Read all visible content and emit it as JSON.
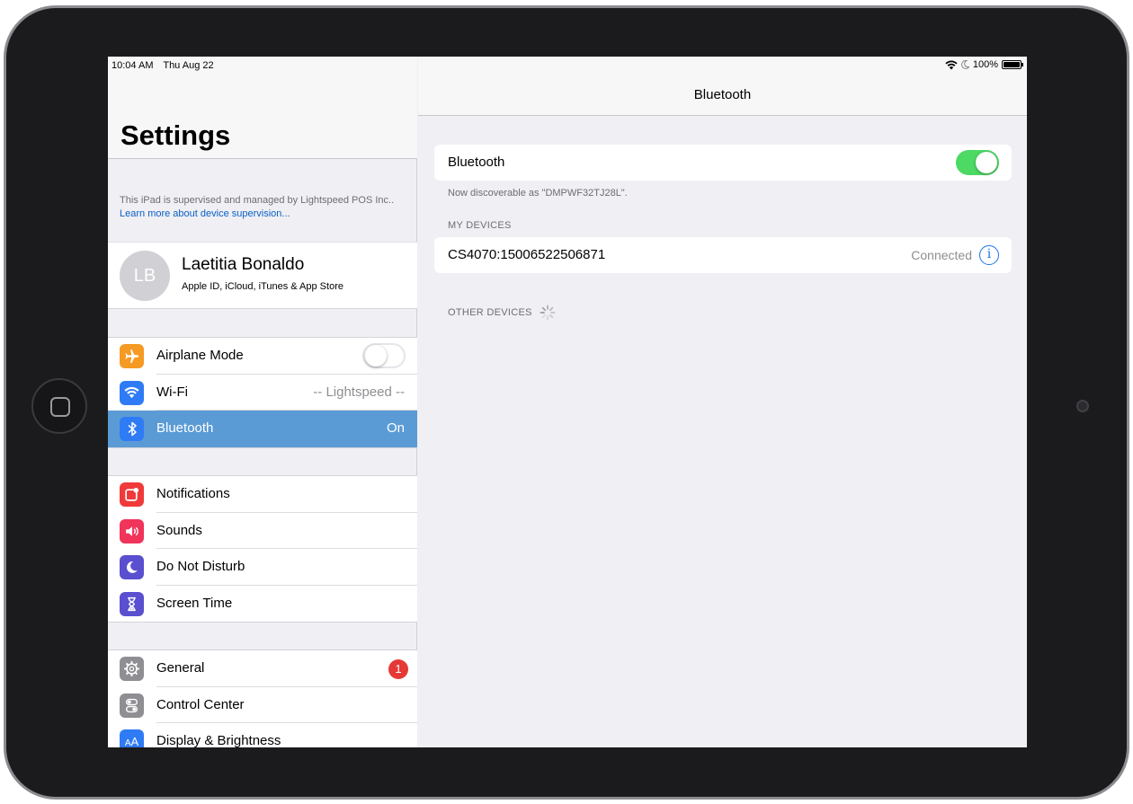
{
  "status_bar": {
    "time": "10:04 AM",
    "date": "Thu Aug 22",
    "battery": "100%"
  },
  "master": {
    "title": "Settings",
    "supervision_text": "This iPad is supervised and managed by Lightspeed POS Inc.. ",
    "supervision_link": "Learn more about device supervision...",
    "profile": {
      "initials": "LB",
      "name": "Laetitia Bonaldo",
      "subtitle": "Apple ID, iCloud, iTunes & App Store"
    },
    "group1": [
      {
        "label": "Airplane Mode",
        "icon": "airplane-icon",
        "color": "#f59a23"
      },
      {
        "label": "Wi-Fi",
        "value": "-- Lightspeed --",
        "icon": "wifi-icon",
        "color": "#2f7bf5"
      },
      {
        "label": "Bluetooth",
        "value": "On",
        "icon": "bluetooth-icon",
        "color": "#2f7bf5"
      }
    ],
    "group2": [
      {
        "label": "Notifications",
        "icon": "notifications-icon",
        "color": "#f03a3a"
      },
      {
        "label": "Sounds",
        "icon": "sounds-icon",
        "color": "#f0345a"
      },
      {
        "label": "Do Not Disturb",
        "icon": "moon-icon",
        "color": "#5a4fcf"
      },
      {
        "label": "Screen Time",
        "icon": "hourglass-icon",
        "color": "#5a4fcf"
      }
    ],
    "group3": [
      {
        "label": "General",
        "badge": "1",
        "icon": "gear-icon",
        "color": "#8e8e93"
      },
      {
        "label": "Control Center",
        "icon": "switches-icon",
        "color": "#8e8e93"
      },
      {
        "label": "Display & Brightness",
        "icon": "text-size-icon",
        "color": "#2f7bf5"
      }
    ]
  },
  "detail": {
    "title": "Bluetooth",
    "bluetooth_label": "Bluetooth",
    "discoverable": "Now discoverable as \"DMPWF32TJ28L\".",
    "my_devices_header": "MY DEVICES",
    "device_name": "CS4070:15006522506871",
    "device_status": "Connected",
    "other_devices_header": "OTHER DEVICES"
  },
  "colors": {
    "selected_row": "#5b9bd5",
    "toggle_on": "#4cd964",
    "link": "#0a60c4"
  }
}
